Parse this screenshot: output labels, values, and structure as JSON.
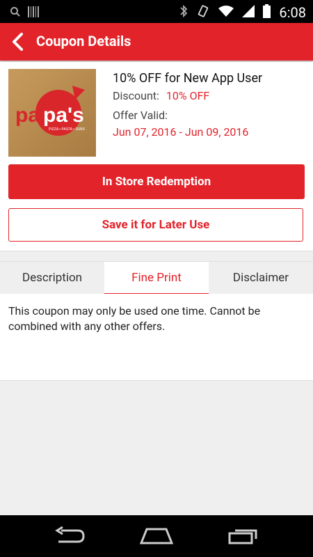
{
  "status_bar": {
    "time": "6:08"
  },
  "app_bar": {
    "title": "Coupon Details"
  },
  "coupon": {
    "logo_text": "papa's",
    "logo_subtext": "PIZZA • PASTA • SUBS",
    "title": "10% OFF for New App User",
    "discount_label": "Discount:",
    "discount_value": "10% OFF",
    "valid_label": "Offer Valid:",
    "valid_dates": "Jun 07, 2016 - Jun 09, 2016"
  },
  "actions": {
    "redeem_label": "In Store Redemption",
    "save_label": "Save it for Later Use"
  },
  "tabs": [
    {
      "label": "Description"
    },
    {
      "label": "Fine Print",
      "active": true
    },
    {
      "label": "Disclaimer"
    }
  ],
  "fine_print": "This coupon may only be used one time. Cannot be combined with any other offers.",
  "colors": {
    "accent": "#e2232a",
    "status_bar": "#000000",
    "background": "#efefef"
  }
}
